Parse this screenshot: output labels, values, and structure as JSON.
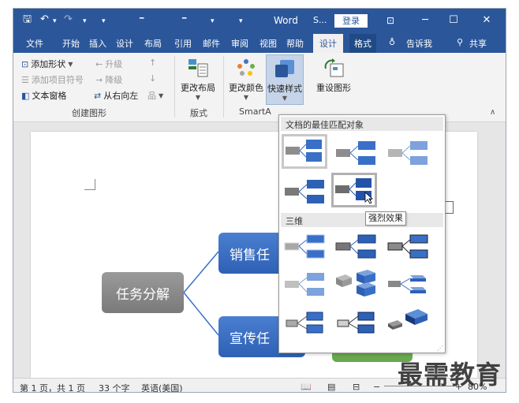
{
  "titlebar": {
    "save_icon": "save-icon",
    "undo_icon": "undo-icon",
    "redo_icon": "redo-icon",
    "app_title": "Word",
    "tab_short": "S...",
    "login_label": "登录",
    "ribbon_display_icon": "ribbon-display-icon",
    "minimize_icon": "minimize-icon",
    "maximize_icon": "maximize-icon",
    "close_icon": "close-icon"
  },
  "tabs": [
    {
      "label": "文件"
    },
    {
      "label": "开始"
    },
    {
      "label": "插入"
    },
    {
      "label": "设计"
    },
    {
      "label": "布局"
    },
    {
      "label": "引用"
    },
    {
      "label": "邮件"
    },
    {
      "label": "审阅"
    },
    {
      "label": "视图"
    },
    {
      "label": "帮助"
    },
    {
      "label": "设计"
    },
    {
      "label": "格式"
    },
    {
      "label": "告诉我"
    },
    {
      "label": "共享"
    }
  ],
  "ribbon": {
    "add_shape": "添加形状",
    "add_bullet": "添加项目符号",
    "text_pane": "文本窗格",
    "promote": "升级",
    "demote": "降级",
    "right_to_left": "从右向左",
    "group_create": "创建图形",
    "change_layout": "更改布局",
    "group_layout": "版式",
    "change_colors": "更改颜色",
    "quick_styles": "快速样式",
    "group_smartart": "SmartA",
    "reset_graphic": "重设图形"
  },
  "document": {
    "root_node": "任务分解",
    "child_top": "销售任",
    "child_bottom": "宣传任"
  },
  "gallery": {
    "section_best": "文档的最佳匹配对象",
    "section_3d": "三维",
    "tooltip": "强烈效果",
    "accent_color": "#3a6fc8"
  },
  "statusbar": {
    "page_info": "第 1 页，共 1 页",
    "word_count": "33 个字",
    "language": "英语(美国)",
    "zoom": "80%"
  },
  "watermark": "最需教育"
}
